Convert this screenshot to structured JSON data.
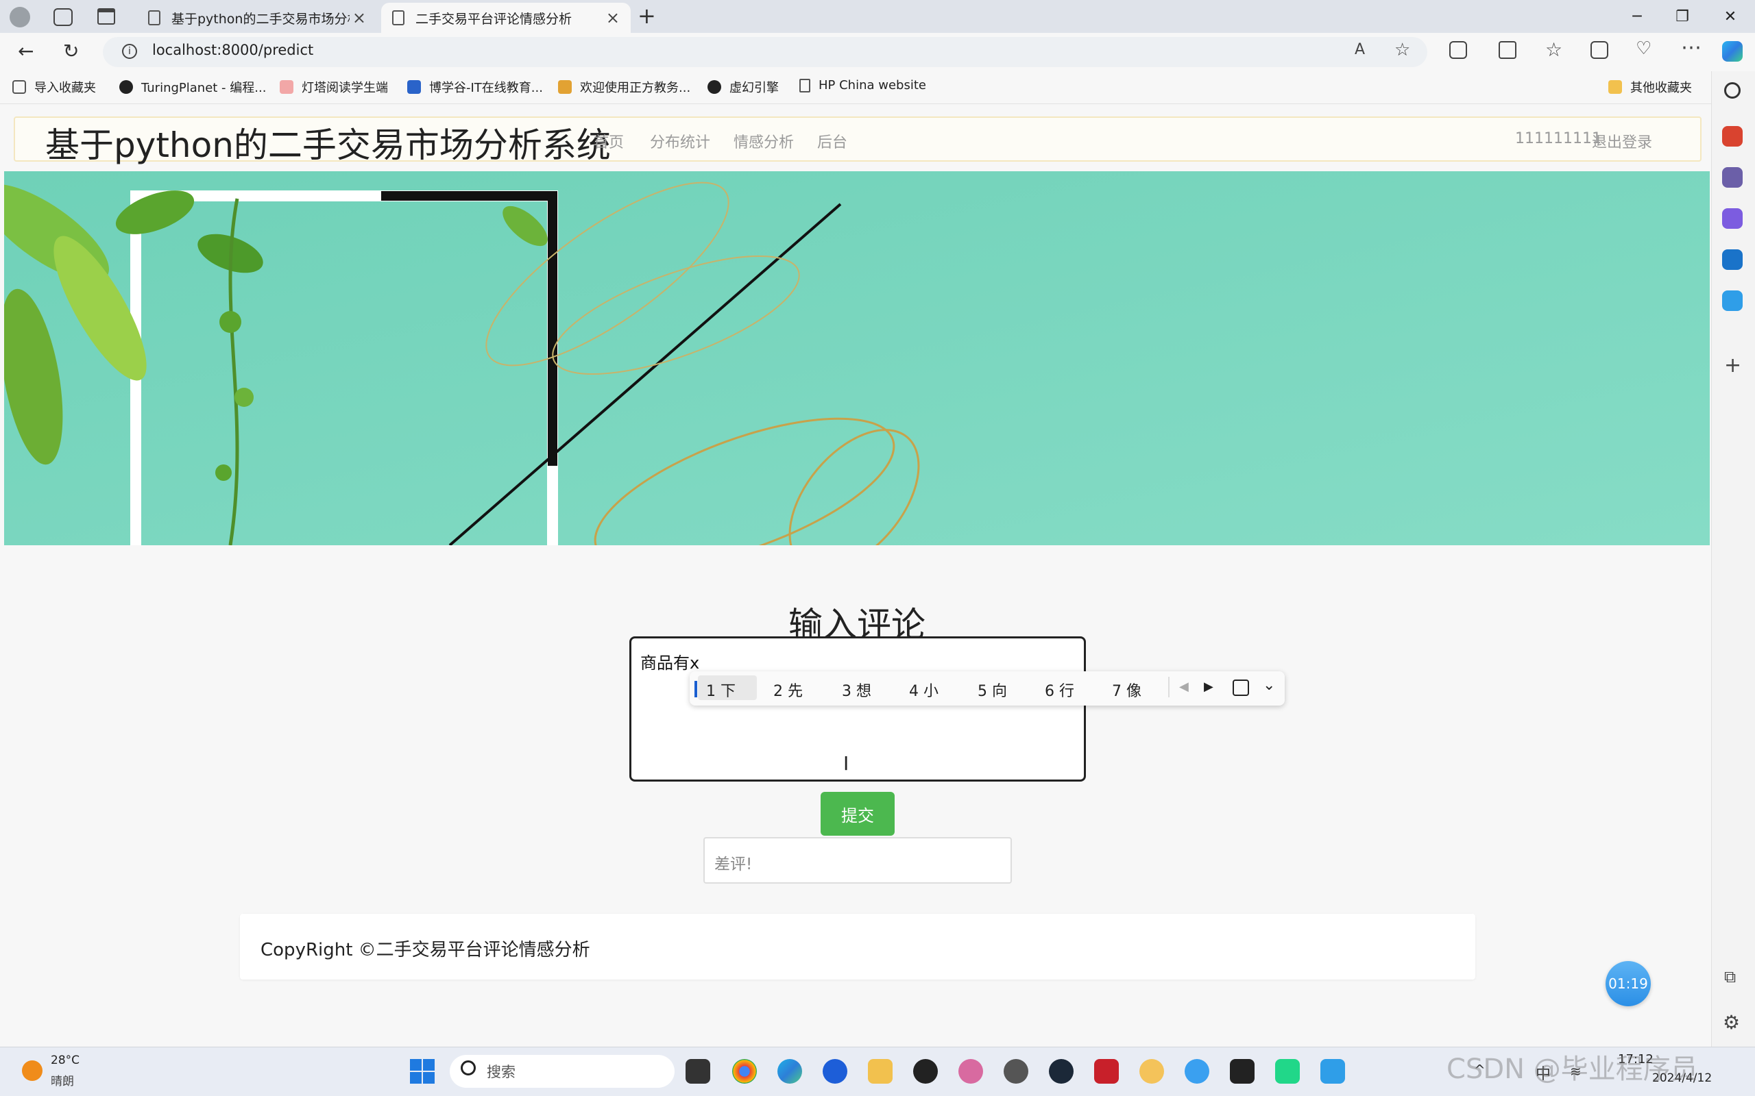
{
  "browser": {
    "tabs": [
      {
        "label": "基于python的二手交易市场分析"
      },
      {
        "label": "二手交易平台评论情感分析"
      }
    ],
    "url": "localhost:8000/predict",
    "bookmarks": [
      {
        "label": "导入收藏夹"
      },
      {
        "label": "TuringPlanet - 编程..."
      },
      {
        "label": "灯塔阅读学生端"
      },
      {
        "label": "博学谷-IT在线教育..."
      },
      {
        "label": "欢迎使用正方教务..."
      },
      {
        "label": "虚幻引擎"
      },
      {
        "label": "HP China website"
      }
    ],
    "other_bookmarks": "其他收藏夹"
  },
  "navbar": {
    "brand": "基于python的二手交易市场分析系统",
    "links": [
      {
        "label": "首页"
      },
      {
        "label": "分布统计"
      },
      {
        "label": "情感分析"
      },
      {
        "label": "后台"
      }
    ],
    "user": "111111111",
    "logout": "退出登录"
  },
  "form": {
    "title": "输入评论",
    "comment_value": "商品有x",
    "submit_label": "提交",
    "result": "差评!"
  },
  "ime": {
    "candidates": [
      "1 下",
      "2 先",
      "3 想",
      "4 小",
      "5 向",
      "6 行",
      "7 像"
    ]
  },
  "footer": {
    "text": "CopyRight ©二手交易平台评论情感分析"
  },
  "timer": "01:19",
  "taskbar": {
    "temperature": "28°C",
    "weather": "晴朗",
    "search_placeholder": "搜索",
    "ime_mode": "中",
    "time": "17:12",
    "date": "2024/4/12",
    "watermark": "CSDN @毕业程序员"
  },
  "colors": {
    "banner": "#7fd9c0",
    "submit": "#4cb84f",
    "navbar_border": "#f4e7c0"
  }
}
